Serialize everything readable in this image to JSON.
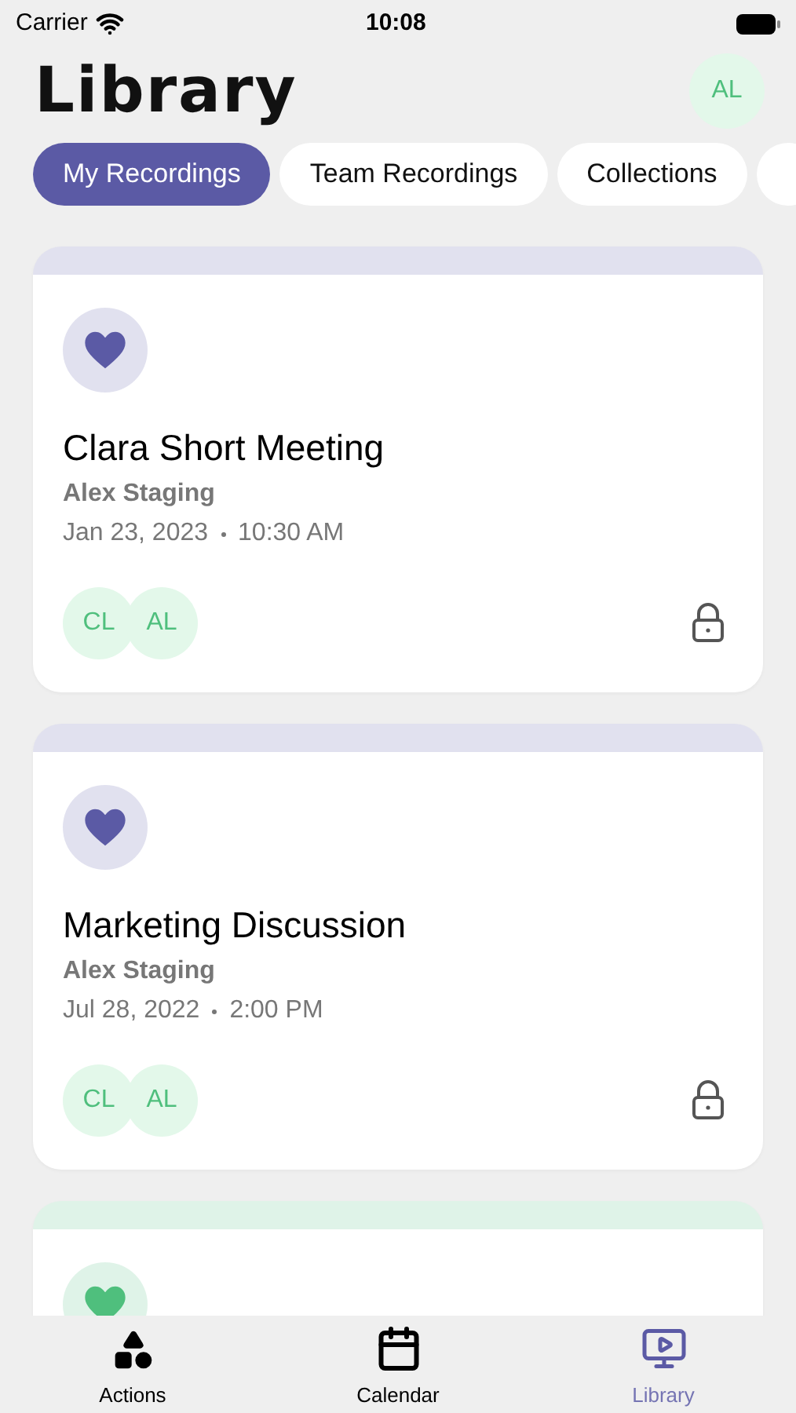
{
  "status_bar": {
    "carrier": "Carrier",
    "time": "10:08"
  },
  "header": {
    "title": "Library",
    "avatar": "AL"
  },
  "chips": [
    {
      "label": "My Recordings",
      "selected": true
    },
    {
      "label": "Team Recordings",
      "selected": false
    },
    {
      "label": "Collections",
      "selected": false
    },
    {
      "selected": false
    }
  ],
  "recordings": [
    {
      "title": "Clara Short Meeting",
      "owner": "Alex Staging",
      "date": "Jan 23, 2023",
      "time": "10:30 AM",
      "participants": [
        "CL",
        "AL"
      ],
      "color": "#5b5aa5",
      "locked": true
    },
    {
      "title": "Marketing Discussion",
      "owner": "Alex Staging",
      "date": "Jul 28, 2022",
      "time": "2:00 PM",
      "participants": [
        "CL",
        "AL"
      ],
      "color": "#5b5aa5",
      "locked": true
    },
    {
      "color": "#4fbf7d"
    }
  ],
  "tab_bar": [
    {
      "label": "Actions",
      "kind": "actions",
      "selected": false
    },
    {
      "label": "Calendar",
      "kind": "calendar",
      "selected": false
    },
    {
      "label": "Library",
      "kind": "library",
      "selected": true
    }
  ]
}
